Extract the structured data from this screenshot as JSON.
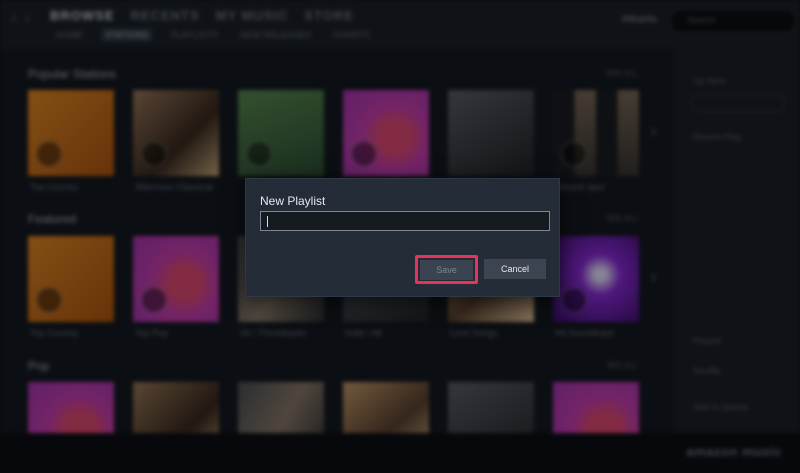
{
  "topbar": {
    "tabs": [
      "BROWSE",
      "RECENTS",
      "MY MUSIC",
      "STORE"
    ],
    "subtabs": [
      "HOME",
      "STATIONS",
      "PLAYLISTS",
      "NEW RELEASES",
      "CHARTS"
    ],
    "user": "Mikaela",
    "search_placeholder": "Search"
  },
  "sections": [
    {
      "title": "Popular Stations",
      "see_more": "SEE ALL",
      "items": [
        "Top Country",
        "Afternoon Classical",
        "",
        "",
        "",
        "Around Jazz"
      ]
    },
    {
      "title": "Featured",
      "see_more": "SEE ALL",
      "items": [
        "Top Country",
        "Top Pop",
        "Alt / Throwbacks",
        "Indie / Alt",
        "Love Songs",
        "Hit Soundtrack"
      ]
    },
    {
      "title": "Pop",
      "see_more": "SEE ALL",
      "items": []
    }
  ],
  "right_panel": {
    "items": [
      "Up Next",
      "Recent Play",
      "Playlist",
      "Shuffle",
      "Add to Queue"
    ]
  },
  "footer": {
    "brand": "amazon music"
  },
  "dialog": {
    "title": "New Playlist",
    "input_value": "",
    "save_label": "Save",
    "cancel_label": "Cancel",
    "highlight_color": "#e8325e"
  }
}
